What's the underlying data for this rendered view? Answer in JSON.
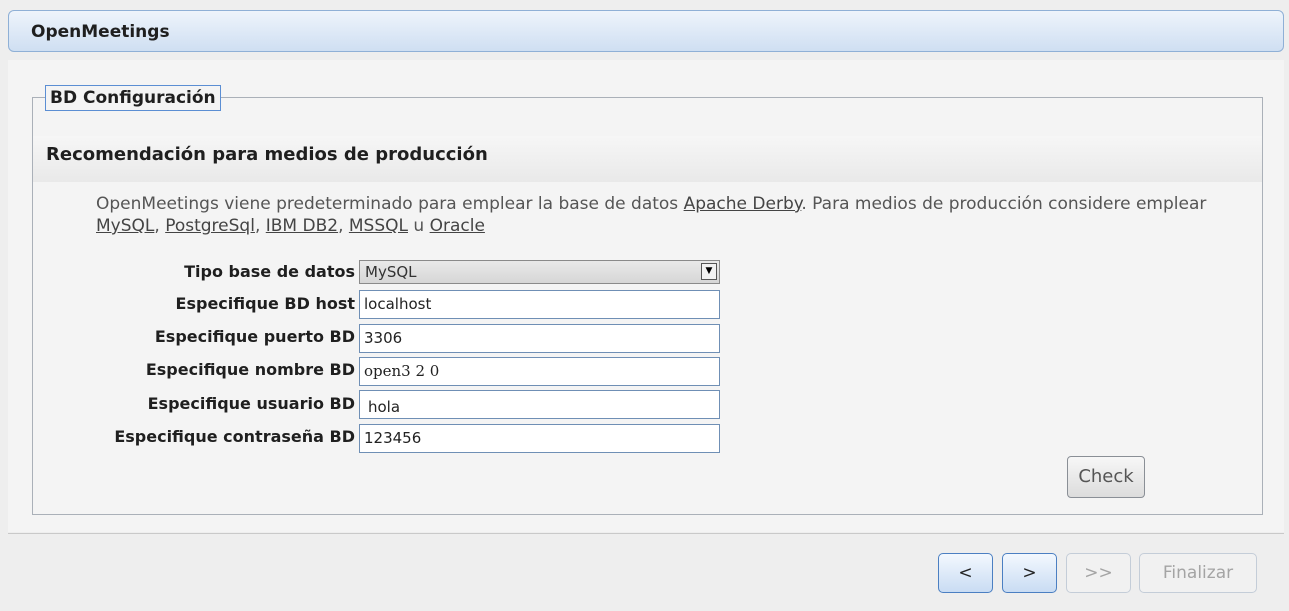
{
  "app": {
    "title": "OpenMeetings"
  },
  "panel": {
    "legend": "BD Configuración",
    "section_title": "Recomendación para medios de producción",
    "description": {
      "before": "OpenMeetings viene predeterminado para emplear la base de datos ",
      "link_derby": "Apache Derby",
      "middle": ". Para medios de producción considere emplear ",
      "link_mysql": "MySQL",
      "comma1": ", ",
      "link_postgres": "PostgreSql",
      "comma2": ", ",
      "link_db2": "IBM DB2",
      "comma3": ", ",
      "link_mssql": "MSSQL",
      "u": " u ",
      "link_oracle": "Oracle"
    }
  },
  "form": {
    "db_type": {
      "label": "Tipo base de datos",
      "value": "MySQL"
    },
    "db_host": {
      "label": "Especifique BD host",
      "value": "localhost"
    },
    "db_port": {
      "label": "Especifique puerto BD",
      "value": "3306"
    },
    "db_name": {
      "label": "Especifique nombre BD",
      "value": "open3 2 0"
    },
    "db_user": {
      "label": "Especifique usuario BD",
      "value": "hola"
    },
    "db_pass": {
      "label": "Especifique contraseña BD",
      "value": "123456"
    },
    "check_label": "Check"
  },
  "nav": {
    "prev": "<",
    "next": ">",
    "last": ">>",
    "finish": "Finalizar"
  }
}
